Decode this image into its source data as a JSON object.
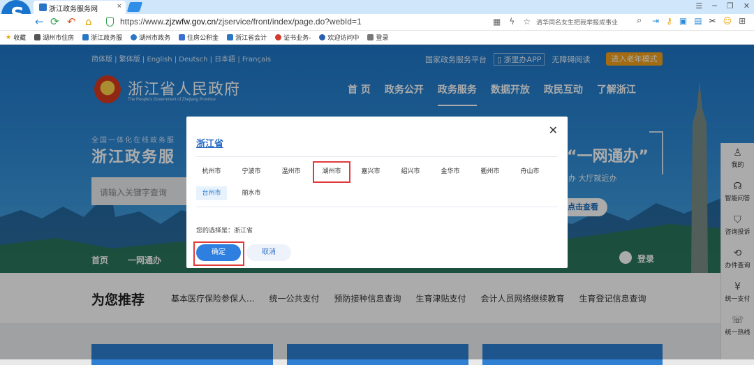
{
  "browser": {
    "tab_title": "浙江政务服务网",
    "url_prefix": "https://www.",
    "url_host": "zjzwfw.gov.cn",
    "url_path": "/zjservice/front/index/page.do?webId=1",
    "search_text": "清华同名女生把我举报成事业",
    "bookmarks": [
      "收藏",
      "湖州市住房",
      "浙江政务服",
      "湖州市政务",
      "住房公积金",
      "浙江省会计",
      "证书业务-",
      "欢迎访问中",
      "登录"
    ]
  },
  "site": {
    "lang_links": "简体版 | 繁体版 | English | Deutsch | 日本語 | Français",
    "gov_platform": "国家政务服务平台",
    "app_label": "浙里办APP",
    "accessible": "无障碍阅读",
    "elder_mode": "进入老年模式",
    "title": "浙江省人民政府",
    "subtitle": "The People's Government of Zhejiang Province",
    "nav": [
      "首  页",
      "政务公开",
      "政务服务",
      "数据开放",
      "政民互动",
      "了解浙江"
    ],
    "active_nav": "政务服务",
    "service_label": "全国一体化在线政务服",
    "service_title": "浙江政务服",
    "search_placeholder": "请输入关键字查询",
    "one_stop": "“一网通办”",
    "hall_text": "办 大厅就近办",
    "view_btn": "点击查看",
    "subnav": [
      "首页",
      "一网通办"
    ],
    "login": "登录"
  },
  "recommend": {
    "title": "为您推荐",
    "items": [
      "基本医疗保险参保人...",
      "统一公共支付",
      "预防接种信息查询",
      "生育津贴支付",
      "会计人员网络继续教育",
      "生育登记信息查询"
    ]
  },
  "side_panel": [
    "我的",
    "智能问答",
    "咨询投诉",
    "办件查询",
    "统一支付",
    "统一热线"
  ],
  "modal": {
    "province": "浙江省",
    "cities_row1": [
      "杭州市",
      "宁波市",
      "温州市",
      "湖州市",
      "嘉兴市",
      "绍兴市",
      "金华市",
      "衢州市",
      "舟山市"
    ],
    "cities_row2": [
      "台州市",
      "丽水市"
    ],
    "choice_label": "您的选择是：浙江省",
    "confirm": "确定",
    "cancel": "取消",
    "close_icon": "close-icon"
  },
  "colors": {
    "primary": "#2f7fe0",
    "highlight": "#e03a3a",
    "elder": "#f3a21b"
  }
}
